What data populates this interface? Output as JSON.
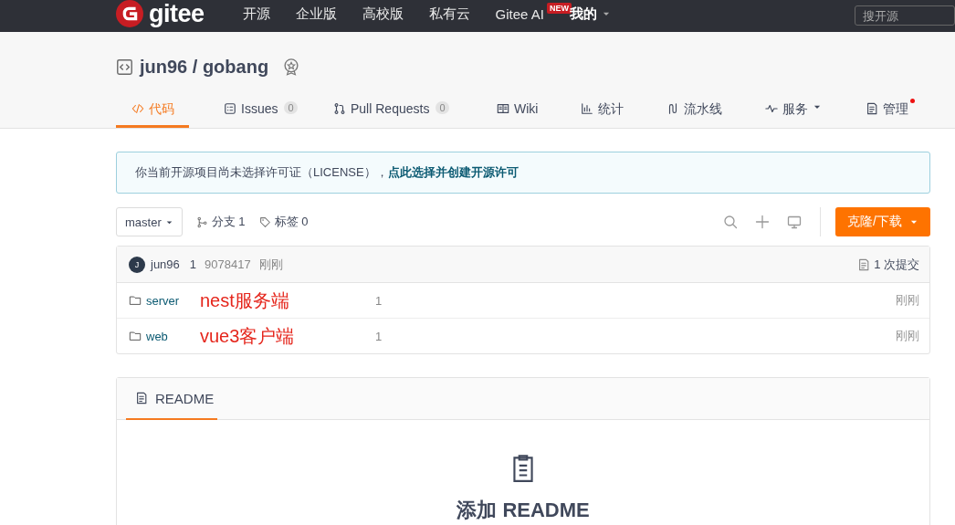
{
  "top_nav": {
    "logo": "gitee",
    "items": [
      {
        "label": "开源",
        "kind": "link"
      },
      {
        "label": "企业版",
        "kind": "link"
      },
      {
        "label": "高校版",
        "kind": "link"
      },
      {
        "label": "私有云",
        "kind": "link"
      },
      {
        "label": "Gitee AI",
        "kind": "link",
        "badge": "NEW"
      },
      {
        "label": "我的",
        "kind": "menu"
      }
    ],
    "search": {
      "placeholder": "搜开源"
    }
  },
  "repo": {
    "title": "jun96 / gobang"
  },
  "tabs": [
    {
      "label": "代码",
      "kind": "code",
      "selected": true
    },
    {
      "label": "Issues",
      "kind": "issues",
      "count": "0",
      "selected": false
    },
    {
      "label": "Pull Requests",
      "kind": "pr",
      "count": "0",
      "selected": false
    },
    {
      "label": "Wiki",
      "kind": "wiki",
      "selected": false
    },
    {
      "label": "统计",
      "kind": "stats",
      "selected": false
    },
    {
      "label": "流水线",
      "kind": "pipeline",
      "selected": false
    },
    {
      "label": "服务",
      "kind": "service",
      "dropdown": true,
      "selected": false
    },
    {
      "label": "管理",
      "kind": "manage",
      "dot": true,
      "selected": false
    }
  ],
  "notice": {
    "text": "你当前开源项目尚未选择许可证（LICENSE），",
    "link": "点此选择并创建开源许可"
  },
  "toolbar": {
    "branch": "master",
    "branches": "分支 1",
    "tags": "标签 0",
    "clone_button": "克隆/下载"
  },
  "commit": {
    "avatar": "J",
    "author": "jun96",
    "message": "1",
    "hash": "9078417",
    "time": "刚刚",
    "count": "1 次提交"
  },
  "files": [
    {
      "name": "server",
      "annotation": "nest服务端",
      "message": "1",
      "time": "刚刚"
    },
    {
      "name": "web",
      "annotation": "vue3客户端",
      "message": "1",
      "time": "刚刚"
    }
  ],
  "readme": {
    "tab": "README",
    "heading": "添加 README"
  }
}
